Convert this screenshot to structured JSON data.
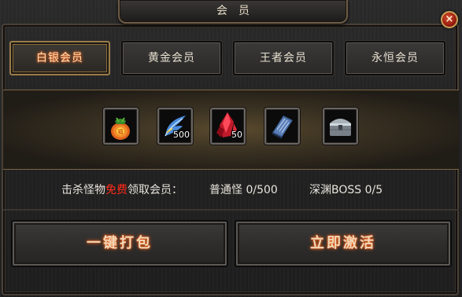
{
  "window": {
    "title": "会员",
    "close_label": "×"
  },
  "tabs": [
    {
      "label": "白银会员",
      "active": true
    },
    {
      "label": "黄金会员",
      "active": false
    },
    {
      "label": "王者会员",
      "active": false
    },
    {
      "label": "永恒会员",
      "active": false
    }
  ],
  "rewards": [
    {
      "icon": "lucky-bag-icon",
      "count": ""
    },
    {
      "icon": "blue-feather-icon",
      "count": "500"
    },
    {
      "icon": "red-crystal-icon",
      "count": "50"
    },
    {
      "icon": "blue-book-icon",
      "count": ""
    },
    {
      "icon": "silver-chest-icon",
      "count": ""
    }
  ],
  "info": {
    "prefix": "击杀怪物",
    "free": "免费",
    "suffix": "领取会员：",
    "normal_monster": "普通怪 0/500",
    "abyss_boss": "深渊BOSS 0/5"
  },
  "buttons": {
    "pack": "一键打包",
    "activate": "立即激活"
  },
  "colors": {
    "accent": "#ff2a1a",
    "gold_border": "#9a7c4a"
  }
}
